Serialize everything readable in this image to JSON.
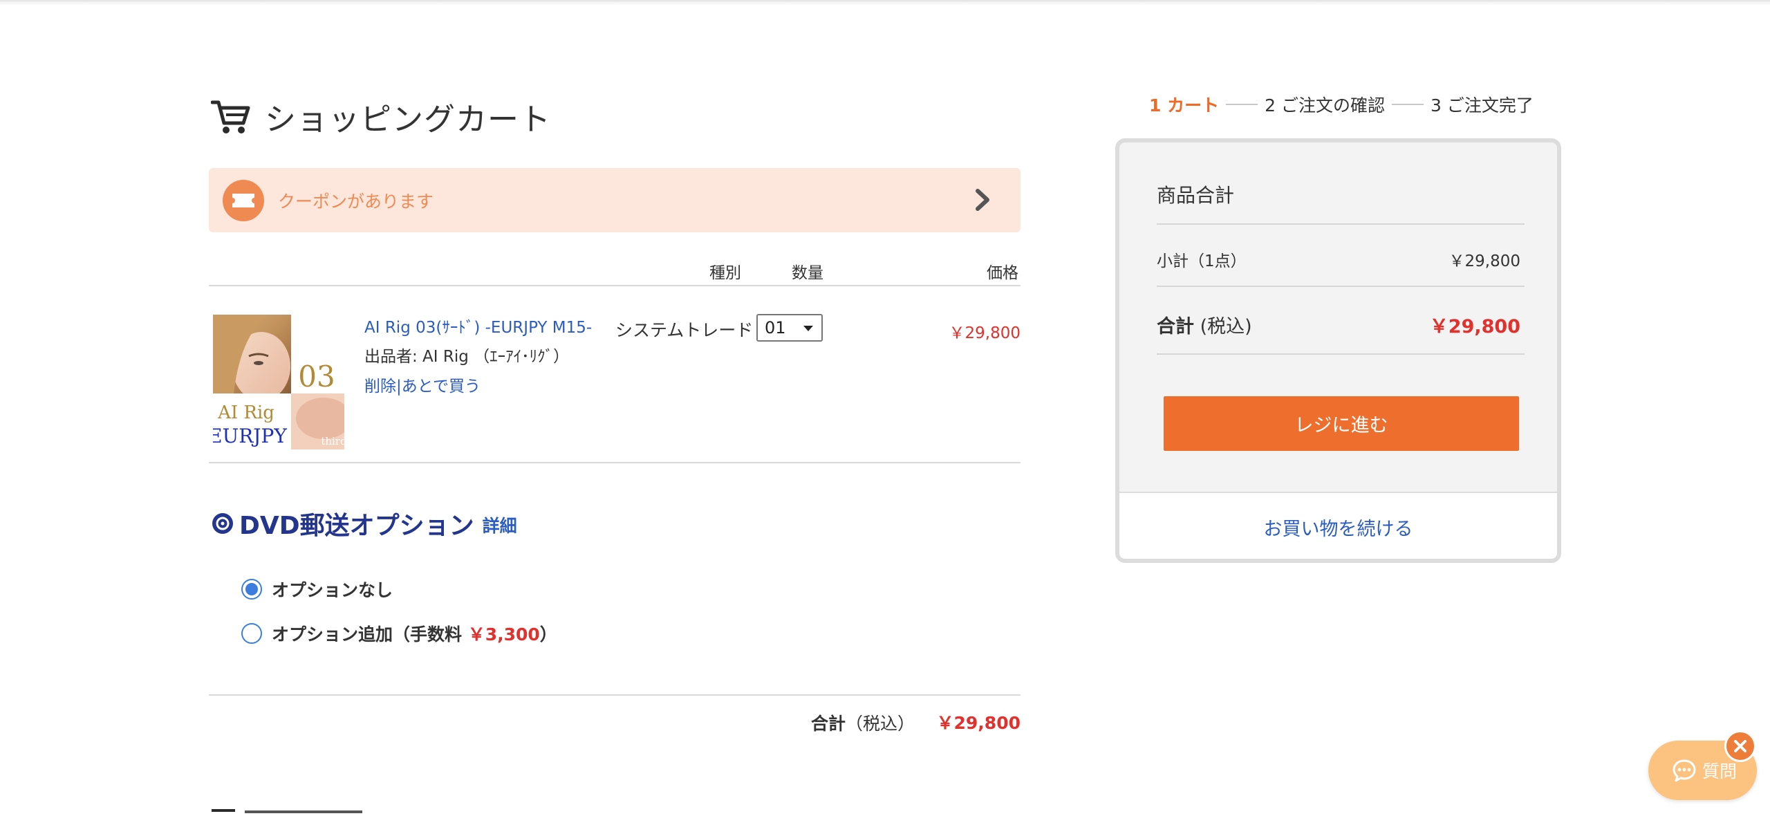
{
  "header": {
    "title": "ショッピングカート"
  },
  "coupon": {
    "label": "クーポンがあります"
  },
  "columns": {
    "type": "種別",
    "quantity": "数量",
    "price": "価格"
  },
  "item": {
    "name": "AI Rig 03(ｻｰﾄﾞ) -EURJPY M15-",
    "seller": "出品者: AI Rig （ｴｰｱｲ･ﾘｸﾞ）",
    "delete": "削除",
    "separator": "|",
    "later": "あとで買う",
    "type": "システムトレード",
    "quantity": "01",
    "price": "￥29,800",
    "thumb": {
      "number": "03",
      "brand": "AI Rig",
      "pair": "EURJPY",
      "tag": "third"
    }
  },
  "dvd": {
    "title": "DVD郵送オプション",
    "detail": "詳細",
    "options": [
      {
        "label": "オプションなし",
        "selected": true
      },
      {
        "label_prefix": "オプション追加（手数料 ",
        "fee": "￥3,300",
        "label_suffix": "）",
        "selected": false
      }
    ]
  },
  "cart_total": {
    "label": "合計",
    "tax": "（税込）",
    "value": "￥29,800"
  },
  "steps": [
    {
      "label": "1 カート",
      "active": true
    },
    {
      "label": "2 ご注文の確認",
      "active": false
    },
    {
      "label": "3 ご注文完了",
      "active": false
    }
  ],
  "summary": {
    "heading": "商品合計",
    "subtotal_label": "小計（1点）",
    "subtotal_value": "￥29,800",
    "total_label": "合計",
    "total_tax": " (税込)",
    "total_value": "￥29,800",
    "checkout": "レジに進む",
    "continue": "お買い物を続ける"
  },
  "chat": {
    "label": "質問"
  },
  "colors": {
    "accent": "#ee6f2d",
    "price": "#e2302c",
    "link": "#2b5cc2",
    "dvd_title": "#23358d"
  }
}
